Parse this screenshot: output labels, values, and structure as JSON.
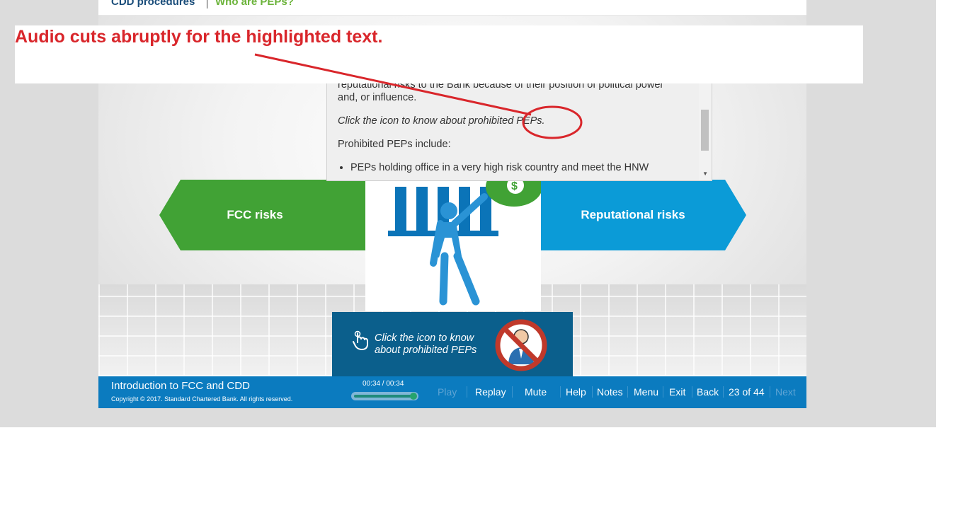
{
  "breadcrumb": {
    "parent": "CDD procedures",
    "current": "Who are PEPs?"
  },
  "annotation": {
    "note": "Audio cuts abruptly for the highlighted text.",
    "color": "#d9262b"
  },
  "popup": {
    "line1": "reputational risks to the Bank because of their position of political power",
    "line2": "and, or influence.",
    "click_hint": "Click the icon to know about prohibited PEPs.",
    "prohibited_intro": "Prohibited PEPs include:",
    "bullet1": "PEPs holding office in a very high risk country and meet the HNW"
  },
  "arrows": {
    "left_label": "FCC risks",
    "right_label": "Reputational risks",
    "left_color": "#41a235",
    "right_color": "#0b9bd7"
  },
  "cta": {
    "line1": "Click the icon to know",
    "line2": "about prohibited PEPs"
  },
  "footer": {
    "course_title": "Introduction to FCC and CDD",
    "copyright": "Copyright © 2017. Standard Chartered Bank. All rights reserved.",
    "time": "00:34 / 00:34",
    "progress": 1.0,
    "play": "Play",
    "replay": "Replay",
    "mute": "Mute",
    "help": "Help",
    "notes": "Notes",
    "menu": "Menu",
    "exit": "Exit",
    "back": "Back",
    "page": "23 of 44",
    "next": "Next"
  },
  "icons": [
    "bank-icon",
    "person-icon",
    "money-bag-icon",
    "hand-pointer-icon",
    "prohibited-person-icon",
    "scroll-down-icon"
  ]
}
